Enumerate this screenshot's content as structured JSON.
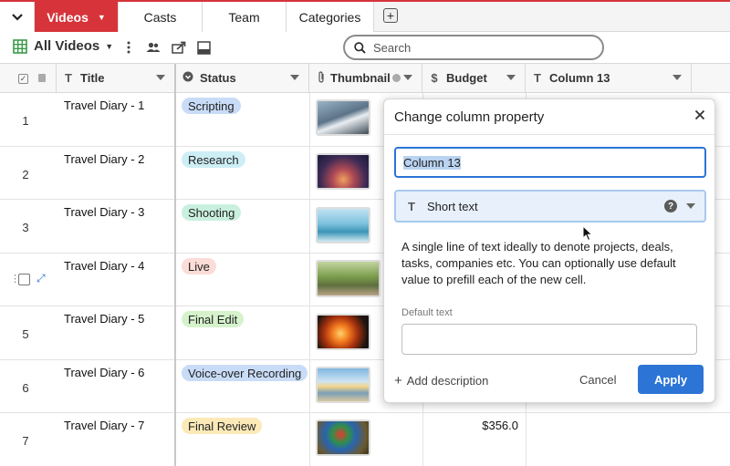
{
  "tabs": [
    {
      "label": "Videos",
      "active": true
    },
    {
      "label": "Casts"
    },
    {
      "label": "Team"
    },
    {
      "label": "Categories"
    }
  ],
  "toolbar": {
    "view_label": "All Videos",
    "search_placeholder": "Search"
  },
  "columns": [
    {
      "label": "Title",
      "icon": "text-icon"
    },
    {
      "label": "Status",
      "icon": "status-icon"
    },
    {
      "label": "Thumbnail",
      "icon": "attachment-icon"
    },
    {
      "label": "Budget",
      "icon": "dollar-icon"
    },
    {
      "label": "Column 13",
      "icon": "text-icon"
    }
  ],
  "rows": [
    {
      "num": "1",
      "title": "Travel Diary - 1",
      "status": "Scripting",
      "status_color": "#c9dcf7",
      "budget": ""
    },
    {
      "num": "2",
      "title": "Travel Diary - 2",
      "status": "Research",
      "status_color": "#cdeef5",
      "budget": ""
    },
    {
      "num": "3",
      "title": "Travel Diary - 3",
      "status": "Shooting",
      "status_color": "#c9f0df",
      "budget": ""
    },
    {
      "num": "",
      "title": "Travel Diary - 4",
      "status": "Live",
      "status_color": "#fbdcd6",
      "budget": ""
    },
    {
      "num": "5",
      "title": "Travel Diary - 5",
      "status": "Final Edit",
      "status_color": "#d6f2cc",
      "budget": ""
    },
    {
      "num": "6",
      "title": "Travel Diary - 6",
      "status": "Voice-over Recording",
      "status_color": "#c9dcf7",
      "budget": ""
    },
    {
      "num": "7",
      "title": "Travel Diary - 7",
      "status": "Final Review",
      "status_color": "#fbe9b8",
      "budget": "$356.0"
    }
  ],
  "dialog": {
    "title": "Change column property",
    "name_value": "Column 13",
    "type_label": "Short text",
    "description": "A single line of text ideally to denote projects, deals, tasks, companies etc. You can optionally use default value to prefill each of the new cell.",
    "default_label": "Default text",
    "default_value": "",
    "add_description": "Add description",
    "cancel": "Cancel",
    "apply": "Apply"
  },
  "colors": {
    "accent_red": "#d6343a",
    "primary_blue": "#2c74d6"
  }
}
